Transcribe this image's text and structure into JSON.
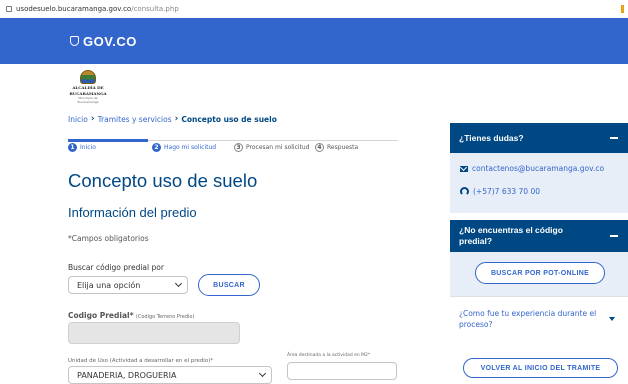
{
  "browser": {
    "url_domain": "usodesuelo.bucaramanga.gov.co",
    "url_path": "/consulta.php"
  },
  "gov_bar": {
    "logo_text": "GOV.CO"
  },
  "crest": {
    "line1": "ALCALDÍA DE",
    "line2": "BUCARAMANGA",
    "line3": "Municipio de Bucaramanga"
  },
  "breadcrumb": {
    "items": [
      "Inicio",
      "Tramites y servicios",
      "Concepto uso de suelo"
    ]
  },
  "steps": [
    {
      "num": "1",
      "label": "Inicio"
    },
    {
      "num": "2",
      "label": "Hago mi solicitud"
    },
    {
      "num": "3",
      "label": "Procesan mi solicitud"
    },
    {
      "num": "4",
      "label": "Respuesta"
    }
  ],
  "main": {
    "title": "Concepto uso de suelo",
    "section_title": "Información del predio",
    "required_note": "*Campos obligatorios",
    "search_label": "Buscar código predial por",
    "search_select_value": "Elija una opción",
    "search_button": "BUSCAR",
    "codigo_label": "Codigo Predial*",
    "codigo_hint": "(Codigo Terreno Predio)",
    "unidad_label": "Unidad de Uso",
    "unidad_hint": "(Actividad a desarrollar en el predio)*",
    "unidad_value": "PANADERIA, DROGUERIA",
    "area_label": "Área destinada a la actividad en M2*"
  },
  "sidebar": {
    "help_title": "¿Tienes dudas?",
    "email": "contactenos@bucaramanga.gov.co",
    "phone": "(+57)7 633 70 00",
    "code_title": "¿No encuentras el código predial?",
    "pot_button": "BUSCAR POR POT-ONLINE",
    "feedback": "¿Como fue tu experiencia durante el proceso?",
    "back_button": "VOLVER AL INICIO DEL TRAMITE"
  },
  "colors": {
    "gov_blue": "#3366cc",
    "dark_blue": "#004884",
    "light_panel": "#e8eef8"
  }
}
